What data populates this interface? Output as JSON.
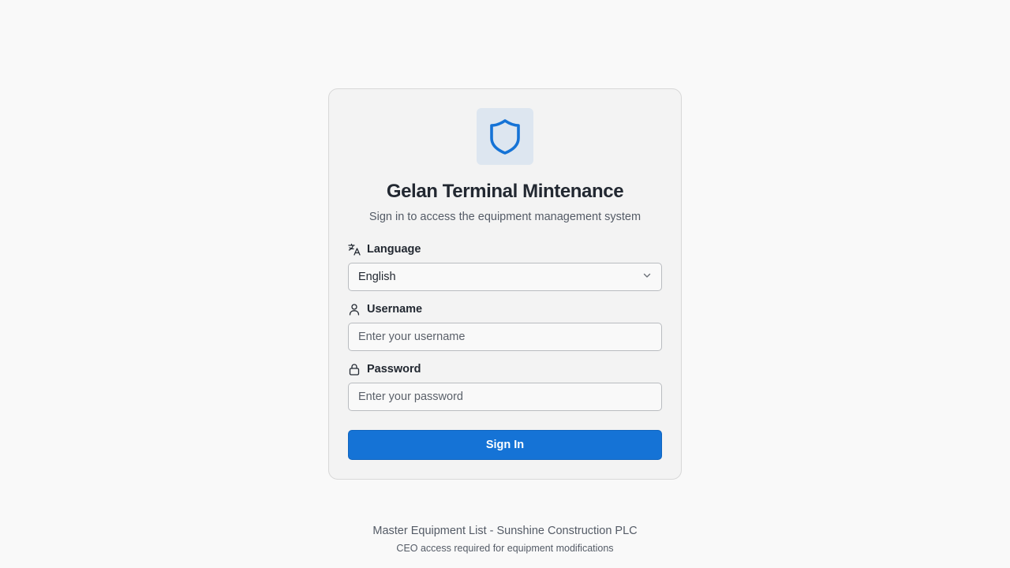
{
  "app": {
    "title": "Gelan Terminal Mintenance",
    "subtitle": "Sign in to access the equipment management system",
    "logo_icon": "shield-icon",
    "accent_color": "#1573d6"
  },
  "form": {
    "language": {
      "label": "Language",
      "icon": "translate-icon",
      "selected": "English"
    },
    "username": {
      "label": "Username",
      "icon": "user-icon",
      "placeholder": "Enter your username",
      "value": ""
    },
    "password": {
      "label": "Password",
      "icon": "lock-icon",
      "placeholder": "Enter your password",
      "value": ""
    },
    "submit_label": "Sign In"
  },
  "footer": {
    "main": "Master Equipment List - Sunshine Construction PLC",
    "sub": "CEO access required for equipment modifications"
  }
}
